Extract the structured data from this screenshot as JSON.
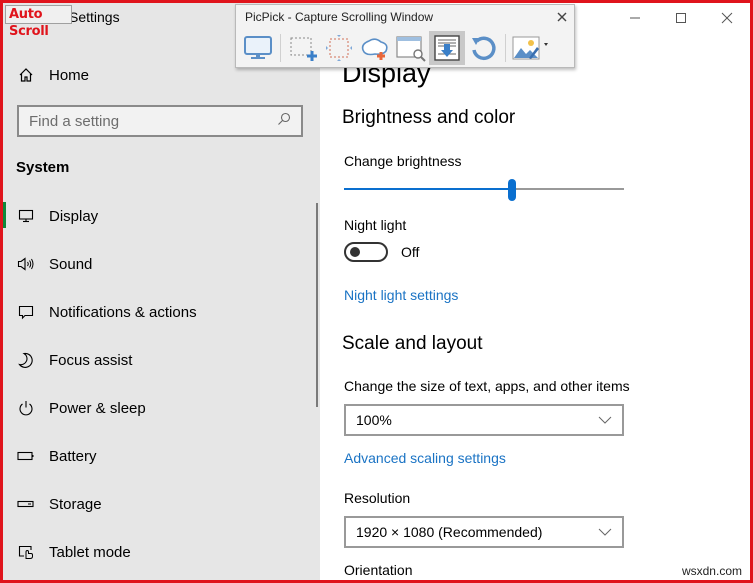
{
  "window": {
    "title": "Settings",
    "controls": {
      "minimize": "minimize-icon",
      "maximize": "maximize-icon",
      "close": "close-icon"
    }
  },
  "overlay_badge": "Auto Scroll",
  "sidebar": {
    "home_label": "Home",
    "search_placeholder": "Find a setting",
    "section_label": "System",
    "items": [
      {
        "label": "Display",
        "icon": "monitor-icon",
        "active": true
      },
      {
        "label": "Sound",
        "icon": "speaker-icon",
        "active": false
      },
      {
        "label": "Notifications & actions",
        "icon": "notification-icon",
        "active": false
      },
      {
        "label": "Focus assist",
        "icon": "moon-icon",
        "active": false
      },
      {
        "label": "Power & sleep",
        "icon": "power-icon",
        "active": false
      },
      {
        "label": "Battery",
        "icon": "battery-icon",
        "active": false
      },
      {
        "label": "Storage",
        "icon": "storage-icon",
        "active": false
      },
      {
        "label": "Tablet mode",
        "icon": "tablet-mode-icon",
        "active": false
      }
    ]
  },
  "main": {
    "page_title": "Display",
    "brightness_section": "Brightness and color",
    "brightness_label": "Change brightness",
    "brightness_value": 0.6,
    "night_light_label": "Night light",
    "night_light_state": "Off",
    "night_light_link": "Night light settings",
    "scale_section": "Scale and layout",
    "scale_label": "Change the size of text, apps, and other items",
    "scale_value": "100%",
    "advanced_scaling_link": "Advanced scaling settings",
    "resolution_label": "Resolution",
    "resolution_value": "1920 × 1080 (Recommended)",
    "orientation_label": "Orientation"
  },
  "picpick": {
    "title": "PicPick - Capture Scrolling Window",
    "tools": [
      "capture-screen-icon",
      "capture-region-icon",
      "capture-fixed-region-icon",
      "capture-freehand-icon",
      "capture-window-icon",
      "capture-scrolling-window-icon",
      "repeat-last-capture-icon",
      "image-editor-icon"
    ],
    "active_tool": "capture-scrolling-window-icon"
  },
  "watermark": "wsxdn.com",
  "colors": {
    "frame_border": "#e0141c",
    "accent": "#0a6fcf",
    "link": "#1a73c4",
    "active_indicator": "#0f8a3c",
    "sidebar_bg": "#e6e6e6"
  }
}
